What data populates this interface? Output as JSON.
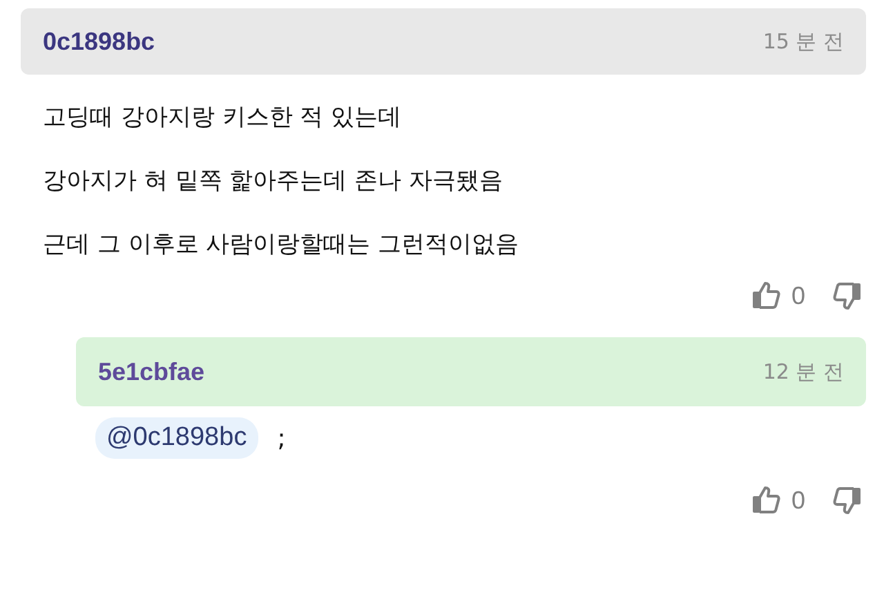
{
  "comments": [
    {
      "kind": "comment",
      "author": "0c1898bc",
      "time": "15 분 전",
      "lines": [
        "고딩때 강아지랑 키스한 적 있는데",
        "강아지가 혀 밑쪽 핥아주는데 존나 자극됐음",
        "근데 그 이후로 사람이랑할때는 그런적이없음"
      ],
      "likes": "0"
    },
    {
      "kind": "reply",
      "author": "5e1cbfae",
      "time": "12 분 전",
      "mention": "@0c1898bc",
      "text": ";",
      "likes": "0"
    }
  ]
}
